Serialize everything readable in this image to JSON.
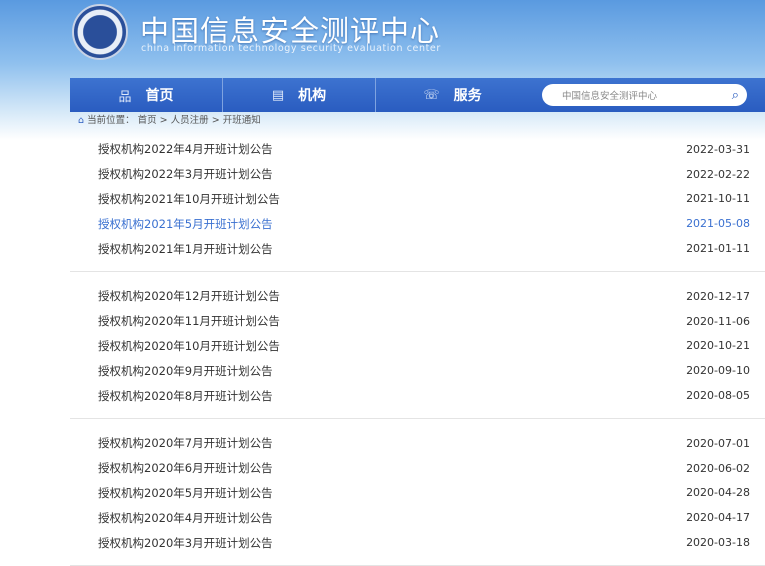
{
  "header": {
    "title": "中国信息安全测评中心",
    "subtitle": "china information technology security evaluation center"
  },
  "nav": [
    {
      "label": "首页",
      "icon": "sitemap-icon"
    },
    {
      "label": "机构",
      "icon": "document-icon"
    },
    {
      "label": "服务",
      "icon": "service-icon"
    }
  ],
  "search": {
    "placeholder": "中国信息安全测评中心"
  },
  "breadcrumb": {
    "prefix": "当前位置：",
    "items": [
      "首页",
      ">",
      "人员注册",
      ">",
      "开班通知"
    ]
  },
  "groups": [
    [
      {
        "title": "授权机构2022年4月开班计划公告",
        "date": "2022-03-31"
      },
      {
        "title": "授权机构2022年3月开班计划公告",
        "date": "2022-02-22"
      },
      {
        "title": "授权机构2021年10月开班计划公告",
        "date": "2021-10-11"
      },
      {
        "title": "授权机构2021年5月开班计划公告",
        "date": "2021-05-08",
        "active": true
      },
      {
        "title": "授权机构2021年1月开班计划公告",
        "date": "2021-01-11"
      }
    ],
    [
      {
        "title": "授权机构2020年12月开班计划公告",
        "date": "2020-12-17"
      },
      {
        "title": "授权机构2020年11月开班计划公告",
        "date": "2020-11-06"
      },
      {
        "title": "授权机构2020年10月开班计划公告",
        "date": "2020-10-21"
      },
      {
        "title": "授权机构2020年9月开班计划公告",
        "date": "2020-09-10"
      },
      {
        "title": "授权机构2020年8月开班计划公告",
        "date": "2020-08-05"
      }
    ],
    [
      {
        "title": "授权机构2020年7月开班计划公告",
        "date": "2020-07-01"
      },
      {
        "title": "授权机构2020年6月开班计划公告",
        "date": "2020-06-02"
      },
      {
        "title": "授权机构2020年5月开班计划公告",
        "date": "2020-04-28"
      },
      {
        "title": "授权机构2020年4月开班计划公告",
        "date": "2020-04-17"
      },
      {
        "title": "授权机构2020年3月开班计划公告",
        "date": "2020-03-18"
      }
    ]
  ]
}
